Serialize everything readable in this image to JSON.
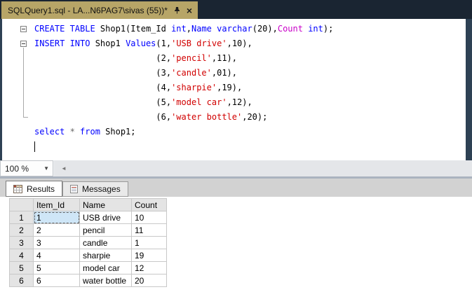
{
  "tab": {
    "title": "SQLQuery1.sql - LA...N6PAG7\\sivas (55))*",
    "close_glyph": "×"
  },
  "editor": {
    "lines": [
      [
        {
          "t": "CREATE TABLE ",
          "c": "kw"
        },
        {
          "t": "Shop1(Item_Id ",
          "c": "pl"
        },
        {
          "t": "int",
          "c": "kw"
        },
        {
          "t": ",",
          "c": "pl"
        },
        {
          "t": "Name",
          "c": "kw"
        },
        {
          "t": " ",
          "c": "pl"
        },
        {
          "t": "varchar",
          "c": "kw"
        },
        {
          "t": "(20),",
          "c": "pl"
        },
        {
          "t": "Count",
          "c": "fn"
        },
        {
          "t": " ",
          "c": "pl"
        },
        {
          "t": "int",
          "c": "kw"
        },
        {
          "t": ");",
          "c": "pl"
        }
      ],
      [
        {
          "t": "INSERT INTO ",
          "c": "kw"
        },
        {
          "t": "Shop1 ",
          "c": "pl"
        },
        {
          "t": "Values",
          "c": "kw"
        },
        {
          "t": "(1,",
          "c": "pl"
        },
        {
          "t": "'USB drive'",
          "c": "str"
        },
        {
          "t": ",10),",
          "c": "pl"
        }
      ],
      [
        {
          "t": "                        (2,",
          "c": "pl"
        },
        {
          "t": "'pencil'",
          "c": "str"
        },
        {
          "t": ",11),",
          "c": "pl"
        }
      ],
      [
        {
          "t": "                        (3,",
          "c": "pl"
        },
        {
          "t": "'candle'",
          "c": "str"
        },
        {
          "t": ",01),",
          "c": "pl"
        }
      ],
      [
        {
          "t": "                        (4,",
          "c": "pl"
        },
        {
          "t": "'sharpie'",
          "c": "str"
        },
        {
          "t": ",19),",
          "c": "pl"
        }
      ],
      [
        {
          "t": "                        (5,",
          "c": "pl"
        },
        {
          "t": "'model car'",
          "c": "str"
        },
        {
          "t": ",12),",
          "c": "pl"
        }
      ],
      [
        {
          "t": "                        (6,",
          "c": "pl"
        },
        {
          "t": "'water bottle'",
          "c": "str"
        },
        {
          "t": ",20);",
          "c": "pl"
        }
      ],
      [
        {
          "t": "select ",
          "c": "kw"
        },
        {
          "t": "* ",
          "c": "op"
        },
        {
          "t": "from ",
          "c": "kw"
        },
        {
          "t": "Shop1;",
          "c": "pl"
        }
      ],
      []
    ]
  },
  "zoom": {
    "level": "100 %"
  },
  "results_tabs": [
    {
      "label": "Results"
    },
    {
      "label": "Messages"
    }
  ],
  "grid": {
    "columns": [
      "Item_Id",
      "Name",
      "Count"
    ],
    "row_numbers": [
      "1",
      "2",
      "3",
      "4",
      "5",
      "6"
    ],
    "rows": [
      [
        "1",
        "USB drive",
        "10"
      ],
      [
        "2",
        "pencil",
        "11"
      ],
      [
        "3",
        "candle",
        "1"
      ],
      [
        "4",
        "sharpie",
        "19"
      ],
      [
        "5",
        "model car",
        "12"
      ],
      [
        "6",
        "water bottle",
        "20"
      ]
    ],
    "selected_cell": {
      "row": 0,
      "col": 0
    }
  },
  "colors": {
    "keyword": "#0000ff",
    "string": "#d10000",
    "builtin_function": "#c800c8",
    "operator": "#666666",
    "tab_bg": "#b7a567",
    "chrome_dark": "#1a2532",
    "editor_frame": "#2e4154",
    "selected_cell_bg": "#cfe6f7"
  }
}
